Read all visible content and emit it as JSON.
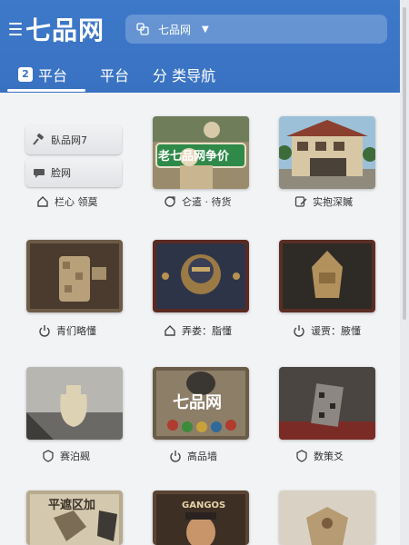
{
  "header": {
    "logo_text": "七品网",
    "selector_text": "七品网",
    "tabs": [
      {
        "badge": "2",
        "label": "平台"
      },
      {
        "label": "平台"
      },
      {
        "label": "分 类导航"
      }
    ]
  },
  "menu": [
    {
      "icon": "gavel-icon",
      "label": "臥品网7"
    },
    {
      "icon": "chat-icon",
      "label": "脸网"
    }
  ],
  "cards": [
    {
      "label": "栏心 领莫",
      "icon": "home-icon"
    },
    {
      "label": "仑遣 · 待货",
      "icon": "refresh-icon",
      "banner_text": "老七品网争价"
    },
    {
      "label": "实抱深贓",
      "icon": "edit-icon"
    },
    {
      "label": "青们略懂",
      "icon": "power-icon"
    },
    {
      "label": "弄娄：脂懂",
      "icon": "home-icon"
    },
    {
      "label": "谖贾：腋懂",
      "icon": "power-icon"
    },
    {
      "label": "赛泊觋",
      "icon": "shield-icon"
    },
    {
      "label": "高品墙",
      "icon": "power-icon",
      "banner_text": "七品网"
    },
    {
      "label": "数策爻",
      "icon": "shield-icon"
    },
    {
      "banner_text": "平遮区加"
    },
    {
      "banner_text": "GANGOS"
    },
    {}
  ],
  "colors": {
    "header_blue": "#3a72c2",
    "background": "#f2f3f5"
  }
}
